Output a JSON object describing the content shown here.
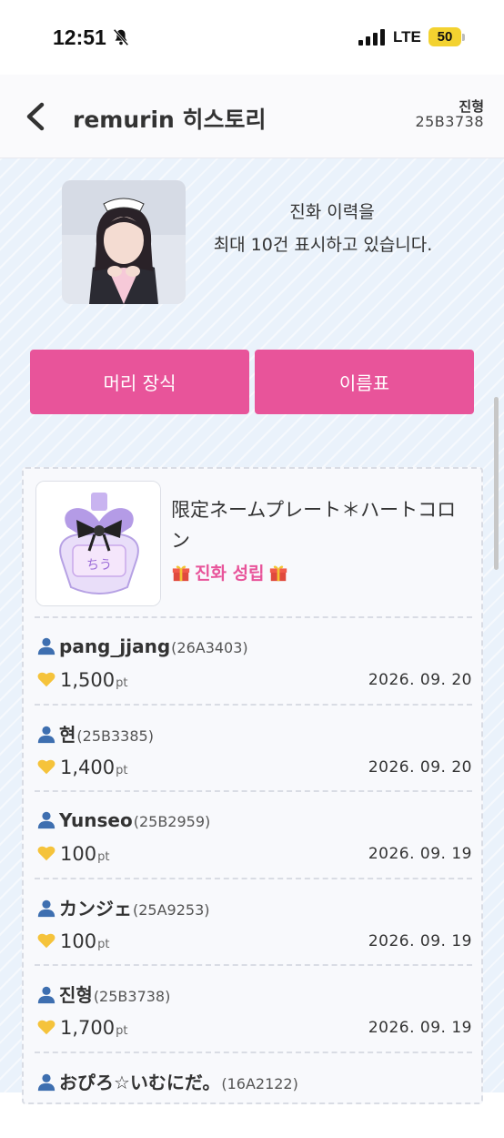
{
  "status_bar": {
    "time": "12:51",
    "network": "LTE",
    "battery": "50"
  },
  "header": {
    "title": "remurin 히스토리",
    "user_name": "진형",
    "user_code": "25B3738"
  },
  "notice": {
    "line1": "진화 이력을",
    "line2": "최대 10건 표시하고 있습니다."
  },
  "buttons": {
    "hair": "머리 장식",
    "nameplate": "이름표"
  },
  "item": {
    "title": "限定ネームプレート＊ハートコロン",
    "status": "진화 성립"
  },
  "entries": [
    {
      "name": "pang_jjang",
      "code": "(26A3403)",
      "points": "1,500",
      "unit": "pt",
      "date": "2026. 09. 20"
    },
    {
      "name": "현",
      "code": "(25B3385)",
      "points": "1,400",
      "unit": "pt",
      "date": "2026. 09. 20"
    },
    {
      "name": "Yunseo",
      "code": "(25B2959)",
      "points": "100",
      "unit": "pt",
      "date": "2026. 09. 19"
    },
    {
      "name": "カンジェ",
      "code": "(25A9253)",
      "points": "100",
      "unit": "pt",
      "date": "2026. 09. 19"
    },
    {
      "name": "진형",
      "code": "(25B3738)",
      "points": "1,700",
      "unit": "pt",
      "date": "2026. 09. 19"
    },
    {
      "name": "おぴろ☆いむにだ。",
      "code": "(16A2122)",
      "points": "",
      "unit": "",
      "date": ""
    }
  ],
  "colors": {
    "accent": "#e8549a",
    "background": "#eaf2fb",
    "battery": "#f3d230"
  },
  "icons": [
    "bell-slash-icon",
    "signal-icon",
    "back-chevron-icon",
    "gift-icon",
    "person-icon",
    "yellow-heart-icon"
  ]
}
